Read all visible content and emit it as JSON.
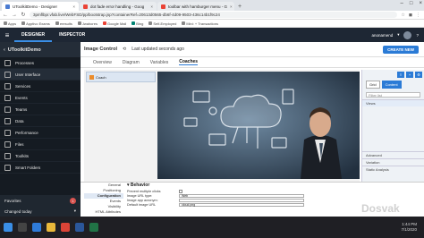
{
  "browser": {
    "tabs": [
      {
        "label": "UToolkitDemo - Designer",
        "active": true
      },
      {
        "label": "dot fade error handling - Goog",
        "active": false
      },
      {
        "label": "toolbar with hamburger menu - G",
        "active": false
      }
    ],
    "url": "3pmflbpr.vfab.live/WebFSD/pp/bootstrap.jsp?containerRef=20613d0565-db6f-4d09-9503-436c14b1f9c24",
    "bookmarks": [
      "Apps",
      "Apptivo Exams",
      "eresults",
      "Jwahores",
      "Google Mail",
      "Bing",
      "Self-Employed",
      "Mini: + Transactions"
    ]
  },
  "app": {
    "tabs": [
      "DESIGNER",
      "INSPECTOR"
    ],
    "active_tab": "DESIGNER",
    "user_name": "anonamend"
  },
  "sidebar": {
    "title": "UToolkitDemo",
    "items": [
      "Processes",
      "User Interface",
      "Services",
      "Events",
      "Teams",
      "Data",
      "Performance",
      "Files",
      "Toolkits",
      "Smart Folders"
    ],
    "active_item": "User Interface",
    "favorites": {
      "label": "Favorites",
      "count": "1"
    },
    "changed": "Changed today"
  },
  "main": {
    "control_title": "Image Control",
    "saved_text": "Last updated seconds ago",
    "create_button": "CREATE NEW",
    "subtabs": [
      "Overview",
      "Diagram",
      "Variables",
      "Coaches"
    ],
    "active_subtab": "Coaches",
    "palette_item": "Coach"
  },
  "right_panel": {
    "buttons": [
      "Grid",
      "Content"
    ],
    "search_placeholder": "Filter list",
    "sections": [
      "Views",
      "Advanced",
      "Variation",
      "Static Analysis"
    ]
  },
  "properties": {
    "categories": [
      "General",
      "Positioning",
      "Configuration",
      "Events",
      "Visibility",
      "HTML Attributes"
    ],
    "active_category": "Configuration",
    "section_behavior": "Behavior",
    "section_appearance": "Appearance",
    "rows": [
      {
        "label": "Prevent multiple clicks",
        "value": ""
      },
      {
        "label": "Image URL type:",
        "value": "Web"
      },
      {
        "label": "Image app acronym:",
        "value": ""
      },
      {
        "label": "Default image URL",
        "value": "cloud.png"
      },
      {
        "label": "Default image URL type:",
        "value": "Web"
      },
      {
        "label": "Default image app acronym",
        "value": ""
      }
    ]
  },
  "watermark": "Dosvak",
  "taskbar": {
    "time": "1:44 PM",
    "date": "7/1/2020"
  },
  "colors": {
    "accent": "#2b7bd6",
    "header": "#1e2734",
    "sidebar": "#151b22"
  }
}
